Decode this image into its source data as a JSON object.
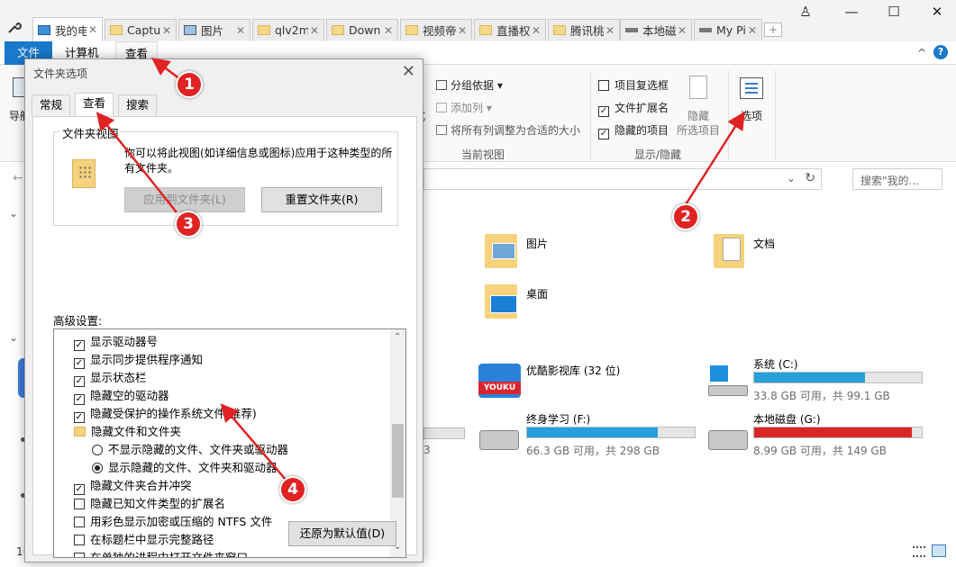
{
  "tabs": [
    {
      "label": "我的电",
      "icon": "computer-icon",
      "active": true
    },
    {
      "label": "Captu",
      "icon": "folder-icon"
    },
    {
      "label": "图片",
      "icon": "image-icon"
    },
    {
      "label": "qlv2m",
      "icon": "folder-icon"
    },
    {
      "label": "Down",
      "icon": "folder-icon"
    },
    {
      "label": "视频帝",
      "icon": "folder-icon"
    },
    {
      "label": "直播权",
      "icon": "folder-icon"
    },
    {
      "label": "腾讯桃",
      "icon": "folder-icon"
    },
    {
      "label": "本地磁",
      "icon": "drive-icon"
    },
    {
      "label": "My Pi",
      "icon": "drive-icon"
    }
  ],
  "window_buttons": {
    "user": "♙",
    "minimize": "—",
    "maximize": "☐",
    "close": "✕"
  },
  "ribbon_tabs": {
    "file": "文件",
    "computer": "计算机",
    "view": "查看"
  },
  "ribbon": {
    "left_label": "导航",
    "group_by": "分组依据",
    "add_column": "添加列",
    "fit_columns": "将所有列调整为合适的大小",
    "style_label": "式",
    "current_view": "当前视图",
    "item_checkbox": "项目复选框",
    "file_ext": "文件扩展名",
    "hidden_items": "隐藏的项目",
    "hide": "隐藏",
    "selected_items": "所选项目",
    "show_hide": "显示/隐藏",
    "options": "选项"
  },
  "address": {
    "search_placeholder": "搜索\"我的..."
  },
  "folders": [
    {
      "name": "图片"
    },
    {
      "name": "文档"
    },
    {
      "name": "桌面"
    }
  ],
  "drives": [
    {
      "name": "优酷影视库 (32 位)",
      "icon": "youku-icon"
    },
    {
      "name": "系统 (C:)",
      "free": "33.8 GB 可用，共 99.1 GB",
      "used_fraction": 0.66
    },
    {
      "name": "终身学习 (F:)",
      "free": "66.3 GB 可用，共 298 GB",
      "used_fraction": 0.78
    },
    {
      "name": "本地磁盘 (G:)",
      "free": "8.99 GB 可用，共 149 GB",
      "used_fraction": 0.94
    }
  ],
  "left_fragments": {
    "count": "1(",
    "partial": "3"
  },
  "youku_text": "YOUKU",
  "dialog": {
    "title": "文件夹选项",
    "close": "✕",
    "tabs": {
      "general": "常规",
      "view": "查看",
      "search": "搜索"
    },
    "folder_view_label": "文件夹视图",
    "folder_view_desc": "你可以将此视图(如详细信息或图标)应用于这种类型的所有文件夹。",
    "apply_button": "应用到文件夹(L)",
    "reset_button": "重置文件夹(R)",
    "advanced_label": "高级设置:",
    "settings": [
      {
        "type": "check",
        "checked": true,
        "label": "显示驱动器号",
        "indent": 0
      },
      {
        "type": "check",
        "checked": true,
        "label": "显示同步提供程序通知",
        "indent": 0
      },
      {
        "type": "check",
        "checked": true,
        "label": "显示状态栏",
        "indent": 0
      },
      {
        "type": "check",
        "checked": true,
        "label": "隐藏空的驱动器",
        "indent": 0
      },
      {
        "type": "check",
        "checked": true,
        "label": "隐藏受保护的操作系统文件(推荐)",
        "indent": 0
      },
      {
        "type": "folder",
        "label": "隐藏文件和文件夹",
        "indent": 0
      },
      {
        "type": "radio",
        "checked": false,
        "label": "不显示隐藏的文件、文件夹或驱动器",
        "indent": 1
      },
      {
        "type": "radio",
        "checked": true,
        "label": "显示隐藏的文件、文件夹和驱动器",
        "indent": 1
      },
      {
        "type": "check",
        "checked": true,
        "label": "隐藏文件夹合并冲突",
        "indent": 0
      },
      {
        "type": "check",
        "checked": false,
        "label": "隐藏已知文件类型的扩展名",
        "indent": 0
      },
      {
        "type": "check",
        "checked": false,
        "label": "用彩色显示加密或压缩的 NTFS 文件",
        "indent": 0
      },
      {
        "type": "check",
        "checked": false,
        "label": "在标题栏中显示完整路径",
        "indent": 0
      },
      {
        "type": "check",
        "checked": false,
        "label": "在单独的进程中打开文件夹窗口",
        "indent": 0
      }
    ],
    "restore_button": "还原为默认值(D)"
  },
  "annotations": [
    "1",
    "2",
    "3",
    "4"
  ]
}
